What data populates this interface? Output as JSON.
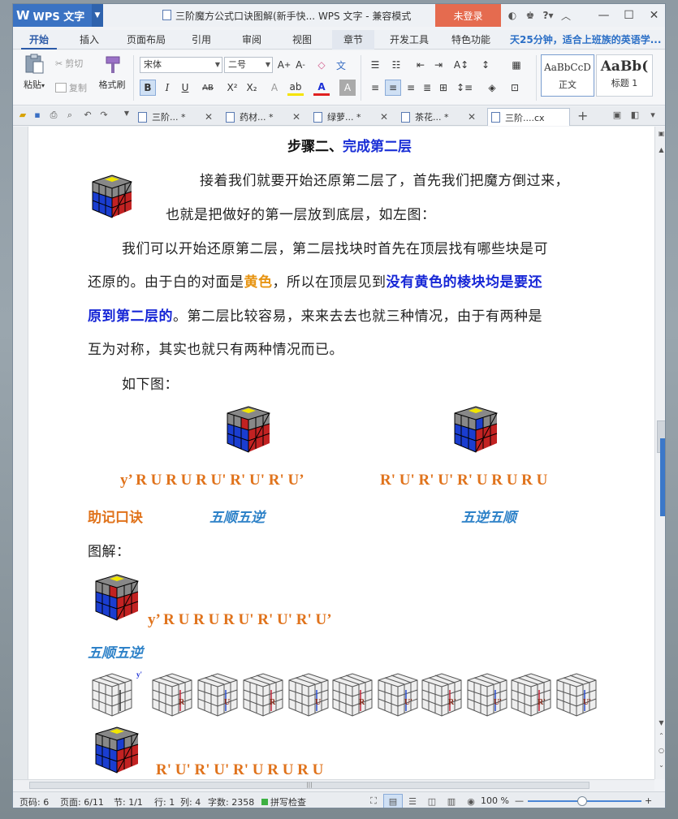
{
  "titlebar": {
    "app_name": "WPS 文字",
    "title": "三阶魔方公式口诀图解(新手快... WPS 文字 - 兼容模式",
    "login": "未登录",
    "help": "?"
  },
  "menu": {
    "tabs": [
      "开始",
      "插入",
      "页面布局",
      "引用",
      "审阅",
      "视图",
      "章节",
      "开发工具",
      "特色功能"
    ],
    "promo": "天25分钟，适合上班族的英语学..."
  },
  "ribbon": {
    "paste": "粘贴",
    "cut": "剪切",
    "copy": "复制",
    "format_painter": "格式刷",
    "font_name": "宋体",
    "font_size": "二号",
    "style_normal_preview": "AaBbCcD",
    "style_normal": "正文",
    "style_h1_preview": "AaBb(",
    "style_h1": "标题 1"
  },
  "doc_tabs": [
    "三阶... *",
    "药材... *",
    "绿萝... *",
    "茶花... *",
    "三阶....cx"
  ],
  "document": {
    "heading_prefix": "步骤二、",
    "heading_main": "完成第二层",
    "p1_line1": "接着我们就要开始还原第二层了，首先我们把魔方倒过来，",
    "p1_line2": "也就是把做好的第一层放到底层，如左图：",
    "p2_line1": "我们可以开始还原第二层，第二层找块时首先在顶层找有哪些块是可",
    "p2_line2_a": "还原的。由于白的对面是",
    "p2_line2_b": "黄色",
    "p2_line2_c": "，所以在顶层见到",
    "p2_line2_d": "没有黄色的棱块均是要还",
    "p2_line3_a": "原到第二层的",
    "p2_line3_b": "。第二层比较容易，来来去去也就三种情况，由于有两种是",
    "p2_line4": "互为对称，其实也就只有两种情况而已。",
    "p3": "如下图：",
    "formula_left": "y’ R U R U R U' R' U' R' U’",
    "formula_right": "R' U' R' U' R' U R U R U",
    "mnemonic_label": "助记口诀",
    "mnemonic_left": "五顺五逆",
    "mnemonic_right": "五逆五顺",
    "diagram_label": "图解：",
    "formula_2": "y’ R U R U R U' R' U' R' U’",
    "mnemonic_2": "五顺五逆",
    "step_y": "y'",
    "steps": [
      "R",
      "U",
      "R",
      "U",
      "R",
      "U'",
      "R'",
      "U'",
      "R'",
      "U'"
    ],
    "formula_3": "R' U' R' U' R' U R U R U"
  },
  "statusbar": {
    "page_code": "页码: 6",
    "page": "页面: 6/11",
    "section": "节: 1/1",
    "row": "行: 1",
    "col": "列: 4",
    "words": "字数: 2358",
    "spell": "拼写检查",
    "zoom": "100 %"
  },
  "colors": {
    "accent": "#3b73c3",
    "login": "#e56b4f",
    "formula_orange": "#e0731c",
    "mnemonic_blue": "#2e82c8",
    "heading_blue": "#1a2fd6",
    "keyword_yellow": "#e79412"
  }
}
